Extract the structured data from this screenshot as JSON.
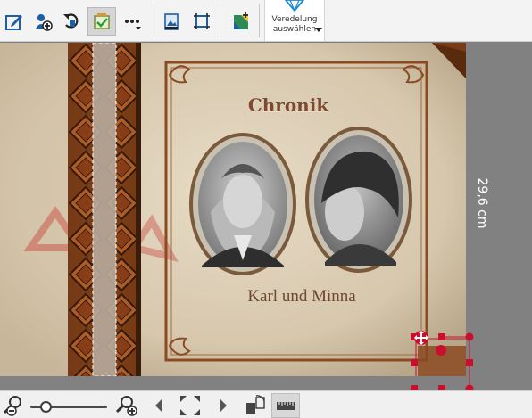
{
  "toolbar": {
    "buttons": [
      {
        "name": "edit-text-icon"
      },
      {
        "name": "add-image-icon"
      },
      {
        "name": "rotate-icon"
      },
      {
        "name": "replace-image-icon"
      },
      {
        "name": "more-options-icon"
      },
      {
        "name": "background-icon"
      },
      {
        "name": "crop-frame-icon"
      },
      {
        "name": "add-clipart-icon"
      }
    ],
    "veredelung_line1": "Veredelung",
    "veredelung_line2": "auswählen"
  },
  "page": {
    "title": "Chronik",
    "names": "Karl und Minna",
    "height_dimension": "29,6 cm"
  },
  "colors": {
    "accent_blue": "#1a8ad6",
    "selection_red": "#c8102e",
    "title_brown": "#7d4a2f",
    "canvas_gray": "#818181"
  },
  "bottombar": {
    "zoom_level": 0.2
  }
}
